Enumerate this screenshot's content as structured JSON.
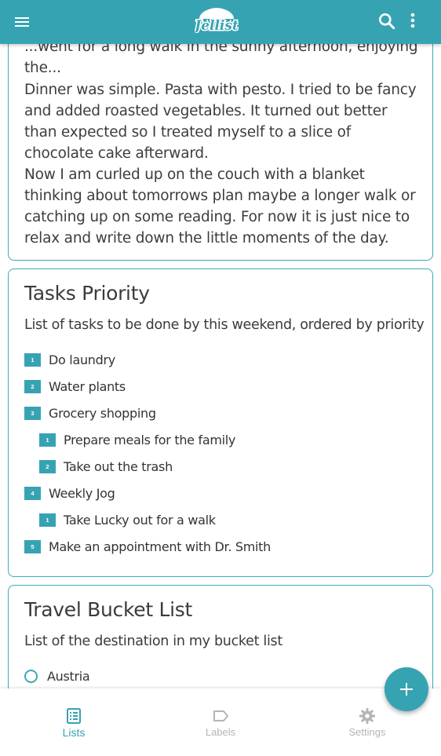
{
  "app": {
    "title": "Jellist"
  },
  "colors": {
    "primary": "#36a3b3",
    "card_border": "#3fa9b5",
    "inactive": "#b5b5b5"
  },
  "header": {
    "menu_icon": "menu-icon",
    "search_icon": "search-icon",
    "more_icon": "more-vert-icon"
  },
  "notes_card": {
    "partial_line": "...went for a long walk in the sunny afternoon, enjoying the...",
    "paragraphs": [
      "Dinner was simple. Pasta with pesto. I tried to be fancy and added roasted vegetables. It turned out better than expected so I treated myself to a slice of chocolate cake afterward.",
      "Now I am curled up on the couch with a blanket thinking about tomorrows plan maybe a longer walk or catching up on some reading. For now it is just nice to relax and write down the little moments of the day."
    ]
  },
  "tasks_card": {
    "title": "Tasks Priority",
    "subtitle": "List of tasks to be done by this weekend, ordered by priority",
    "items": [
      {
        "num": "1",
        "label": "Do laundry"
      },
      {
        "num": "2",
        "label": "Water plants"
      },
      {
        "num": "3",
        "label": "Grocery shopping"
      },
      {
        "num": "1",
        "label": "Prepare meals for the family"
      },
      {
        "num": "2",
        "label": "Take out the trash"
      },
      {
        "num": "4",
        "label": "Weekly Jog"
      },
      {
        "num": "1",
        "label": "Take Lucky out for a walk"
      },
      {
        "num": "5",
        "label": "Make an appointment with Dr. Smith"
      }
    ]
  },
  "travel_card": {
    "title": "Travel Bucket List",
    "subtitle": "List of the destination in my bucket list",
    "items": [
      {
        "label": "Austria",
        "checked": false
      }
    ]
  },
  "fab": {
    "icon": "plus-icon"
  },
  "bottom_nav": {
    "items": [
      {
        "label": "Lists",
        "icon": "list-icon",
        "active": true
      },
      {
        "label": "Labels",
        "icon": "label-icon",
        "active": false
      },
      {
        "label": "Settings",
        "icon": "gear-icon",
        "active": false
      }
    ]
  }
}
